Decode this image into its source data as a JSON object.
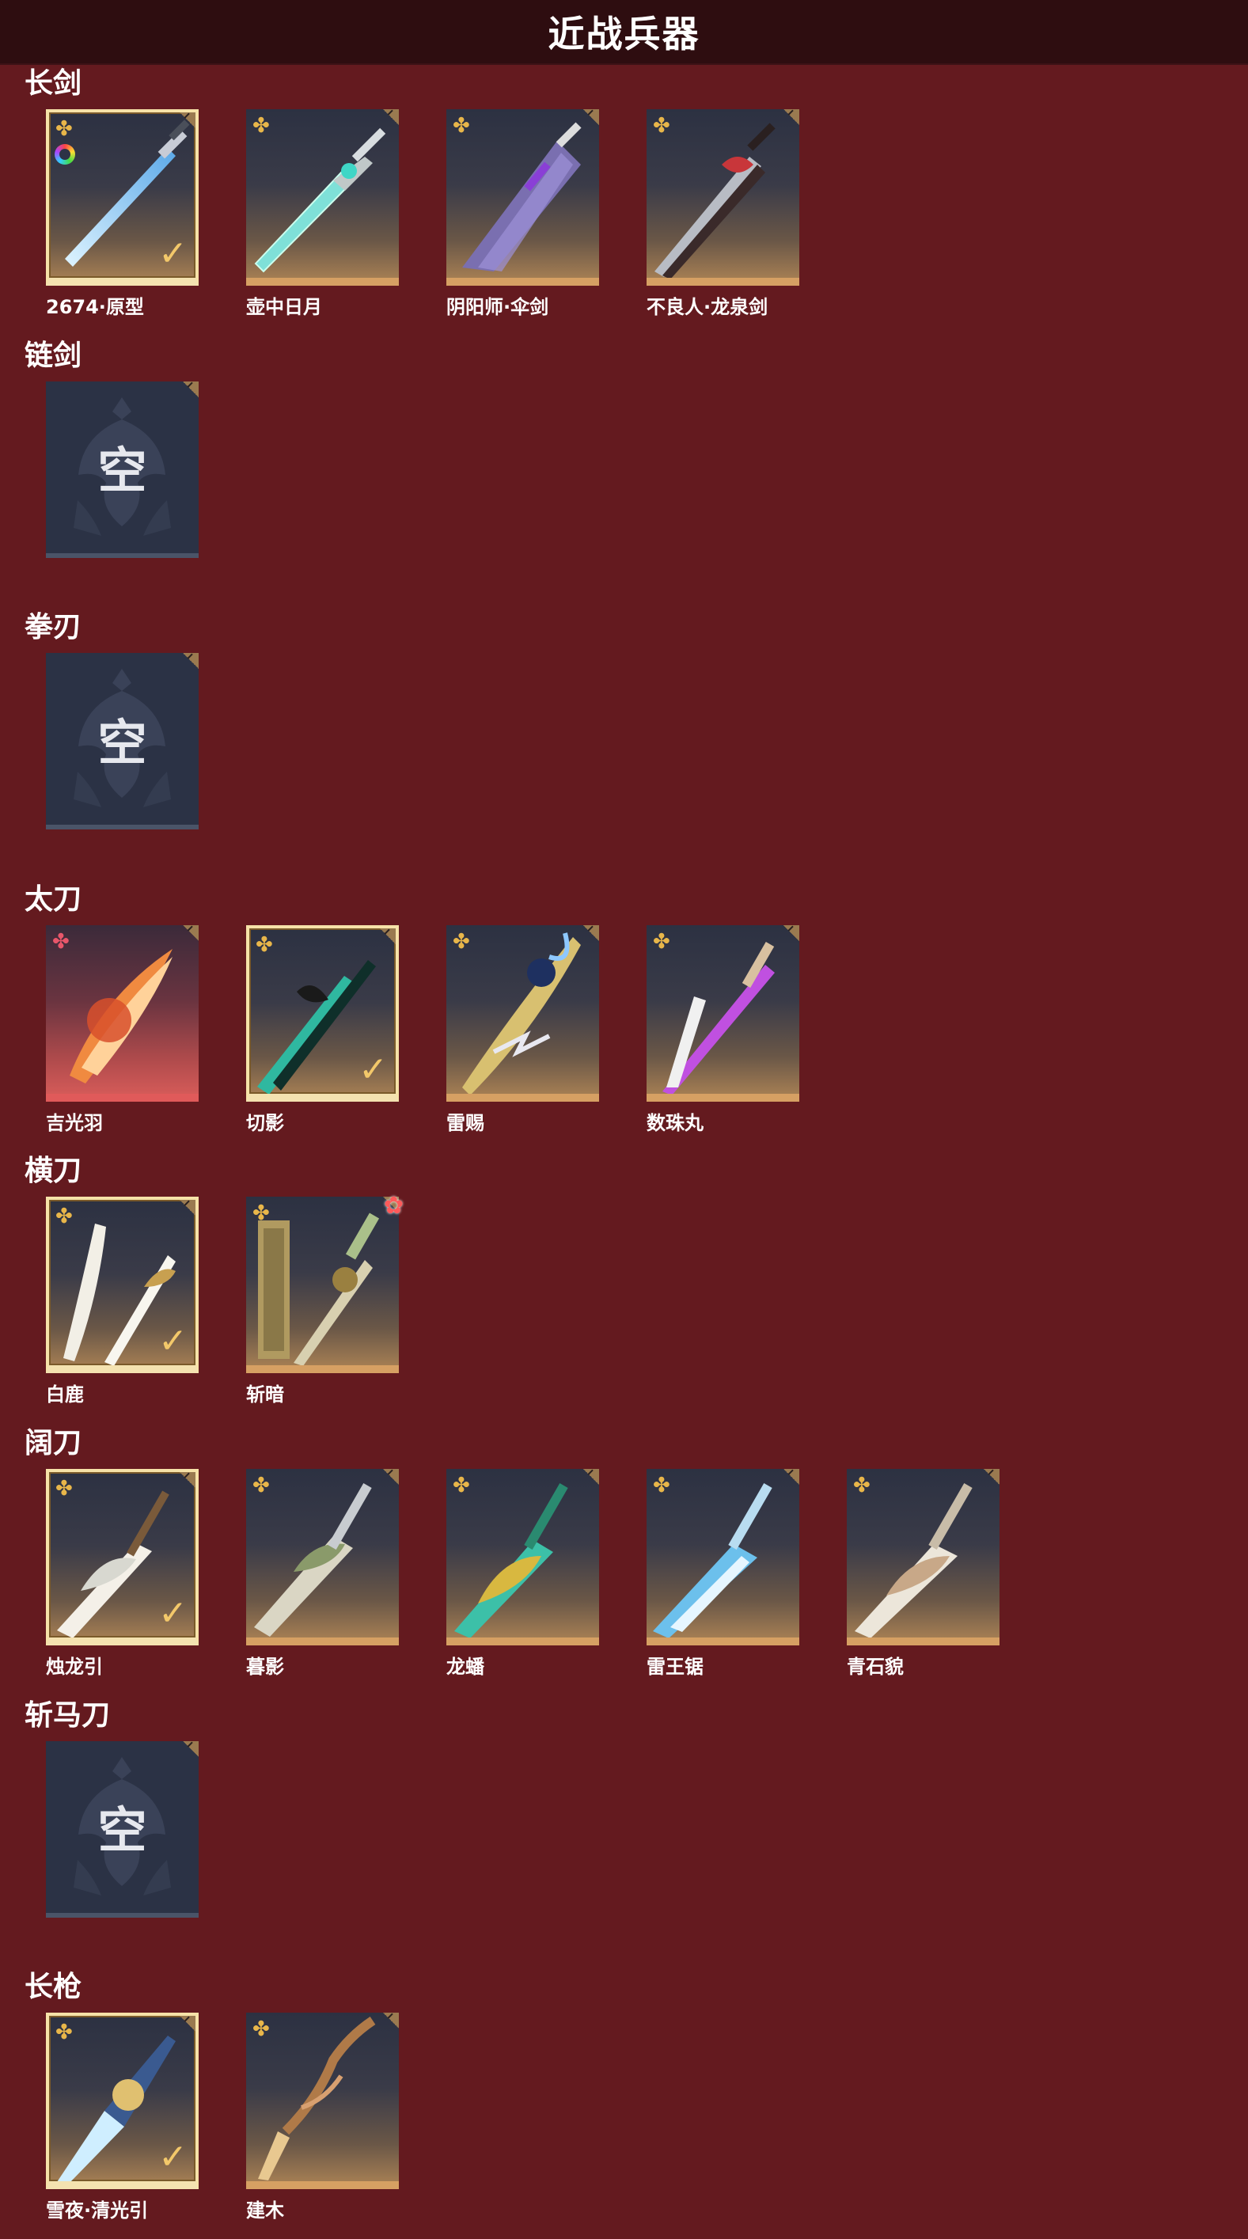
{
  "header": {
    "title": "近战兵器"
  },
  "empty_label": "空",
  "icons": {
    "rarity": "gold-flower-icon",
    "rarity_red": "pink-flower-icon",
    "equipped": "check-icon",
    "corner": "corner-tag-icon",
    "empty": "empty-crest-icon"
  },
  "colors": {
    "background": "#641a1f",
    "titlebar": "#2e0d10",
    "tile_border": "#d6a063",
    "selected_border": "#f6e2a8",
    "check": "#f3c86a",
    "red_tile": "#d35a58"
  },
  "sections": [
    {
      "title": "长剑",
      "items": [
        {
          "name": "2674·原型",
          "equipped": true,
          "colorful_mark": true,
          "weapon": "energy-sword"
        },
        {
          "name": "壶中日月",
          "equipped": false,
          "weapon": "jade-sword"
        },
        {
          "name": "阴阳师·伞剑",
          "equipped": false,
          "weapon": "umbrella-sword"
        },
        {
          "name": "不良人·龙泉剑",
          "equipped": false,
          "weapon": "dark-sword"
        }
      ]
    },
    {
      "title": "链剑",
      "items": [
        {
          "empty": true
        }
      ]
    },
    {
      "title": "拳刃",
      "items": [
        {
          "empty": true
        }
      ]
    },
    {
      "title": "太刀",
      "items": [
        {
          "name": "吉光羽",
          "equipped": false,
          "red": true,
          "weapon": "flame-blade"
        },
        {
          "name": "切影",
          "equipped": true,
          "weapon": "teal-blade"
        },
        {
          "name": "雷赐",
          "equipped": false,
          "weapon": "thunder-blade"
        },
        {
          "name": "数珠丸",
          "equipped": false,
          "weapon": "purple-blade"
        }
      ]
    },
    {
      "title": "横刀",
      "items": [
        {
          "name": "白鹿",
          "equipped": true,
          "weapon": "white-blade"
        },
        {
          "name": "斩暗",
          "equipped": false,
          "flower_badge": true,
          "weapon": "bronze-blade"
        }
      ]
    },
    {
      "title": "阔刀",
      "items": [
        {
          "name": "烛龙引",
          "equipped": true,
          "weapon": "dragon-glaive"
        },
        {
          "name": "暮影",
          "equipped": false,
          "weapon": "bone-glaive"
        },
        {
          "name": "龙蟠",
          "equipped": false,
          "weapon": "jade-glaive"
        },
        {
          "name": "雷王锯",
          "equipped": false,
          "weapon": "ice-glaive"
        },
        {
          "name": "青石貌",
          "equipped": false,
          "weapon": "stone-glaive"
        }
      ]
    },
    {
      "title": "斩马刀",
      "items": [
        {
          "empty": true
        }
      ]
    },
    {
      "title": "长枪",
      "items": [
        {
          "name": "雪夜·清光引",
          "equipped": true,
          "weapon": "ice-spear"
        },
        {
          "name": "建木",
          "equipped": false,
          "weapon": "wood-spear"
        }
      ]
    }
  ]
}
